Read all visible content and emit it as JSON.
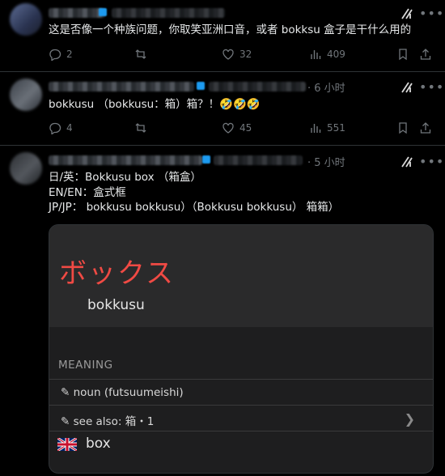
{
  "posts": [
    {
      "time": "",
      "text": "这是否像一个种族问题，你取笑亚洲口音，或者 bokksu 盒子是干什么用的",
      "replies": "2",
      "reposts": "",
      "likes": "32",
      "views": "409"
    },
    {
      "time": "· 6 小时",
      "text": "bokkusu （bokkusu：箱）箱？！🤣🤣🤣",
      "replies": "4",
      "reposts": "",
      "likes": "45",
      "views": "551"
    },
    {
      "time": "· 5 小时",
      "lines": [
        "日/英：Bokkusu box （箱盒）",
        "EN/EN：盒式框",
        "JP/JP： bokkusu bokkusu）（Bokkusu bokkusu） 箱箱）"
      ]
    }
  ],
  "dictionary": {
    "word": "ボックス",
    "reading": "bokkusu",
    "meaning_header": "MEANING",
    "pos": "✎ noun (futsuumeishi)",
    "see_also": "✎ see also: 箱・1",
    "translation": "box"
  },
  "icons": [
    "grok-icon",
    "more-icon",
    "reply-icon",
    "repost-icon",
    "like-icon",
    "views-icon",
    "bookmark-icon",
    "share-icon",
    "chevron-right-icon",
    "uk-flag-icon"
  ],
  "colors": {
    "background": "#000000",
    "muted": "#71767b",
    "katakana": "#f04a44",
    "link_blue": "#1d9bf0"
  }
}
